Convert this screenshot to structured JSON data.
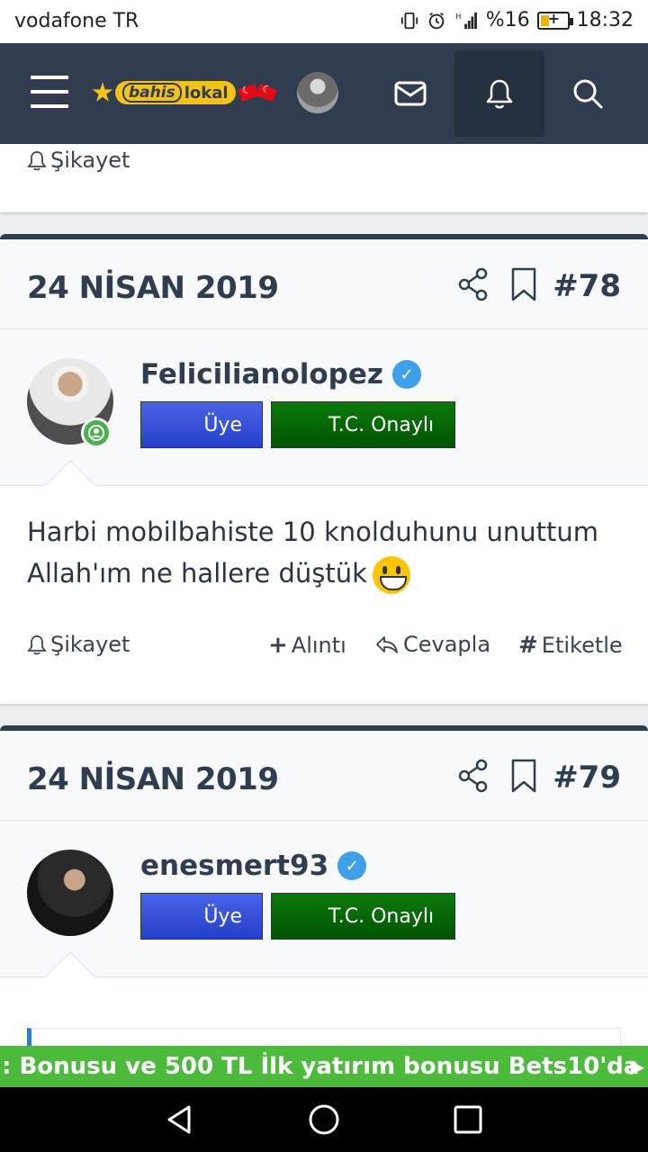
{
  "status_bar": {
    "carrier": "vodafone TR",
    "battery_percent": "%16",
    "battery_level": 0.16,
    "time": "18:32",
    "icons": [
      "vibrate-icon",
      "alarm-icon",
      "signal-icon",
      "battery-icon"
    ]
  },
  "header": {
    "logo_part1": "bahis",
    "logo_part2": "lokal",
    "icons": [
      "menu-icon",
      "mail-icon",
      "bell-icon",
      "search-icon"
    ]
  },
  "top_card": {
    "report_label": "Şikayet"
  },
  "posts": [
    {
      "date": "24 NİSAN 2019",
      "number": "#78",
      "username": "Felicilianolopez",
      "badge_member": "Üye",
      "badge_verified": "T.C. Onaylı",
      "online": true,
      "text_line1": "Harbi mobilbahiste 10 knolduhunu unuttum",
      "text_line2": "Allah'ım ne hallere düştük",
      "actions": {
        "report": "Şikayet",
        "quote": "Alıntı",
        "reply": "Cevapla",
        "tag": "Etiketle"
      }
    },
    {
      "date": "24 NİSAN 2019",
      "number": "#79",
      "username": "enesmert93",
      "badge_member": "Üye",
      "badge_verified": "T.C. Onaylı",
      "online": false
    }
  ],
  "ad_banner": {
    "text": ": Bonusu ve 500 TL İlk yatırım bonusu Bets10'da"
  },
  "nav": {
    "icons": [
      "back-icon",
      "home-icon",
      "recents-icon"
    ]
  },
  "colors": {
    "header_bg": "#2f3d4f",
    "member_badge": "#2440c8",
    "verified_badge": "#005400",
    "ad_bg": "#4cbb3c",
    "verify_check": "#3ea0e8"
  }
}
